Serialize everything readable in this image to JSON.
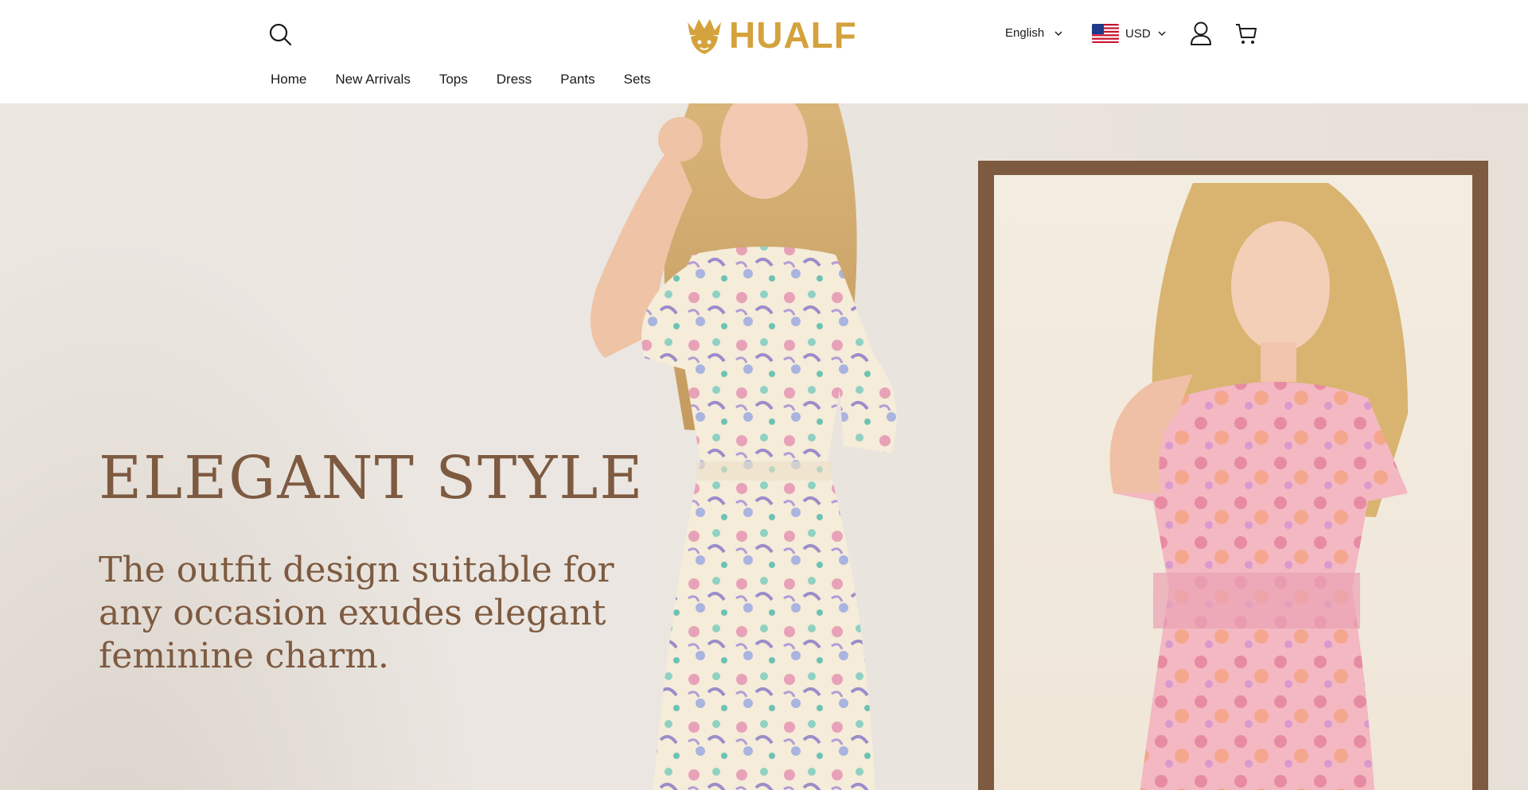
{
  "brand": {
    "name": "HUALF",
    "color": "#d4a23c"
  },
  "header": {
    "language": "English",
    "currency": "USD",
    "icons": {
      "search": "search-icon",
      "account": "user-icon",
      "cart": "cart-icon",
      "dropdown": "chevron-down-icon",
      "flag": "us-flag-icon"
    }
  },
  "nav": {
    "items": [
      {
        "label": "Home"
      },
      {
        "label": "New Arrivals"
      },
      {
        "label": "Tops"
      },
      {
        "label": "Dress"
      },
      {
        "label": "Pants"
      },
      {
        "label": "Sets"
      }
    ]
  },
  "hero": {
    "title": "ELEGANT STYLE",
    "subtitle": "The outfit design suitable for any occasion exudes elegant feminine charm.",
    "accent_color": "#7d5a40",
    "background": "#ebe6e0"
  }
}
